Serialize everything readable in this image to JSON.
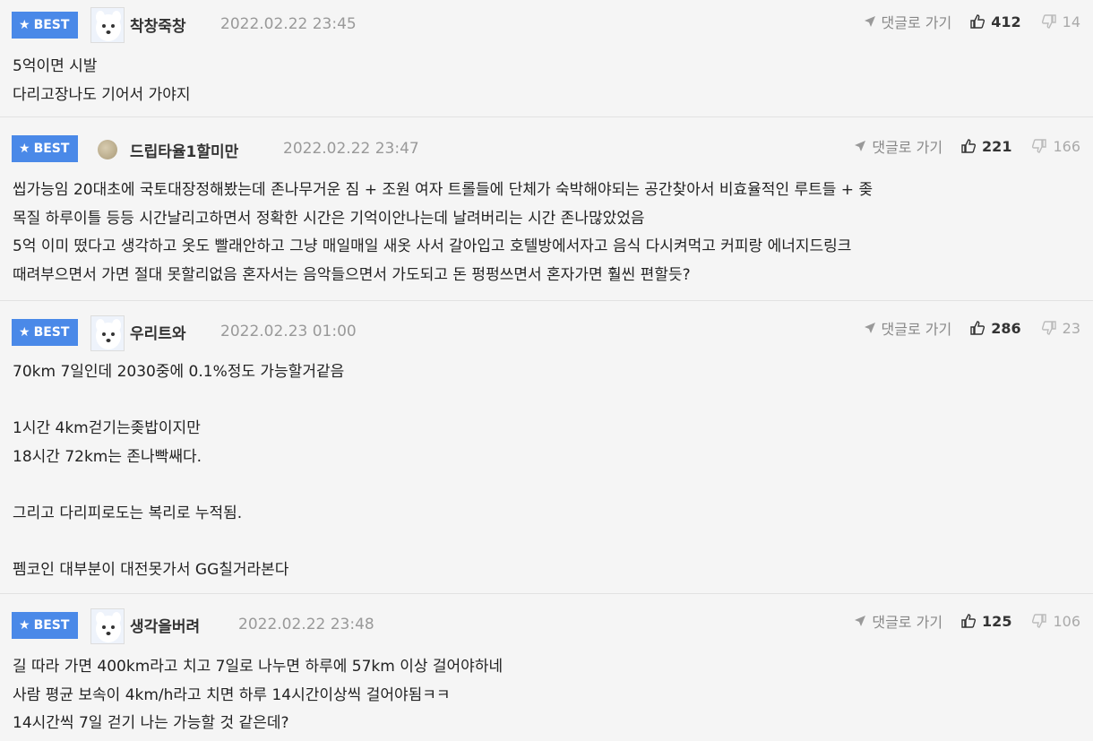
{
  "badge_label": "BEST",
  "reply_label": "댓글로 가기",
  "comments": [
    {
      "nick": "착창죽창",
      "date": "2022.02.22 23:45",
      "up": "412",
      "down": "14",
      "avatar": "dog-avatar",
      "lines": [
        "5억이면 시발",
        "다리고장나도 기어서 가야지"
      ]
    },
    {
      "nick": "드립타율1할미만",
      "date": "2022.02.22 23:47",
      "up": "221",
      "down": "166",
      "avatar": "dot-avatar",
      "lines": [
        "씹가능임 20대초에 국토대장정해봤는데 존나무거운 짐 + 조원 여자 트롤들에 단체가 숙박해야되는 공간찾아서 비효율적인 루트들 + 좆",
        "목질 하루이틀 등등 시간날리고하면서 정확한 시간은 기억이안나는데 날려버리는 시간 존나많았었음",
        "5억 이미 떴다고 생각하고 옷도 빨래안하고 그냥 매일매일 새옷 사서 갈아입고 호텔방에서자고 음식 다시켜먹고 커피랑 에너지드링크",
        "때려부으면서 가면 절대 못할리없음 혼자서는 음악들으면서 가도되고 돈 펑펑쓰면서 혼자가면 훨씬 편할듯?"
      ]
    },
    {
      "nick": "우리트와",
      "date": "2022.02.23 01:00",
      "up": "286",
      "down": "23",
      "avatar": "dog-avatar",
      "lines": [
        "70km 7일인데 2030중에 0.1%정도 가능할거같음",
        "",
        "1시간 4km걷기는좆밥이지만",
        "18시간 72km는 존나빡쌔다.",
        "",
        "그리고 다리피로도는 복리로 누적됨.",
        "",
        "펨코인 대부분이 대전못가서 GG칠거라본다"
      ]
    },
    {
      "nick": "생각을버려",
      "date": "2022.02.22 23:48",
      "up": "125",
      "down": "106",
      "avatar": "dog-avatar",
      "lines": [
        "길 따라 가면 400km라고 치고 7일로 나누면 하루에 57km 이상 걸어야하네",
        "사람 평균 보속이 4km/h라고 치면 하루 14시간이상씩 걸어야됨ㅋㅋ",
        "14시간씩 7일 걷기 나는 가능할 것 같은데?"
      ]
    }
  ]
}
